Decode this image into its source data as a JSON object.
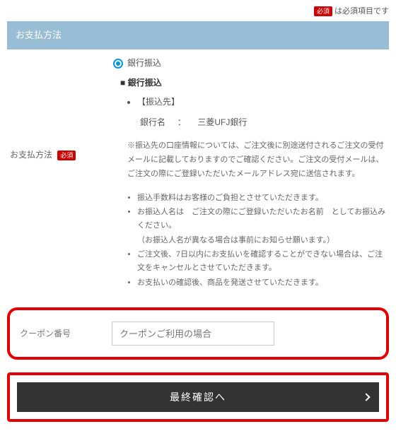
{
  "required_note": {
    "badge": "必須",
    "text": "は必須項目です"
  },
  "section_header": "お支払方法",
  "payment": {
    "label": "お支払方法",
    "badge": "必須",
    "radio_label": "銀行振込",
    "sub_heading": "銀行振込",
    "destination_label": "【振込先】",
    "bank_name_label": "銀行名",
    "bank_separator": "：",
    "bank_name_value": "三菱UFJ銀行",
    "note": "※振込先の口座情報については、ご注文後に別途送付されるご注文の受付メールに記載しておりますのでご確認ください。ご注文の受付メールは、ご注文の際にご登録いただいたメールアドレス宛に送信されます。",
    "bullets": [
      "振込手数料はお客様のご負担とさせていただきます。",
      "お振込人名は　ご注文の際にご登録いただいたお名前　としてお振込みください。",
      "（お振込人名が異なる場合は事前にお知らせ願います。）",
      "ご注文後、7日以内にお支払いを確認することができない場合は、ご注文をキャンセルとさせていただきます。",
      "お支払いの確認後、商品を発送させていただきます。"
    ]
  },
  "coupon": {
    "label": "クーポン番号",
    "placeholder": "クーポンご利用の場合"
  },
  "confirm_label": "最終確認へ"
}
